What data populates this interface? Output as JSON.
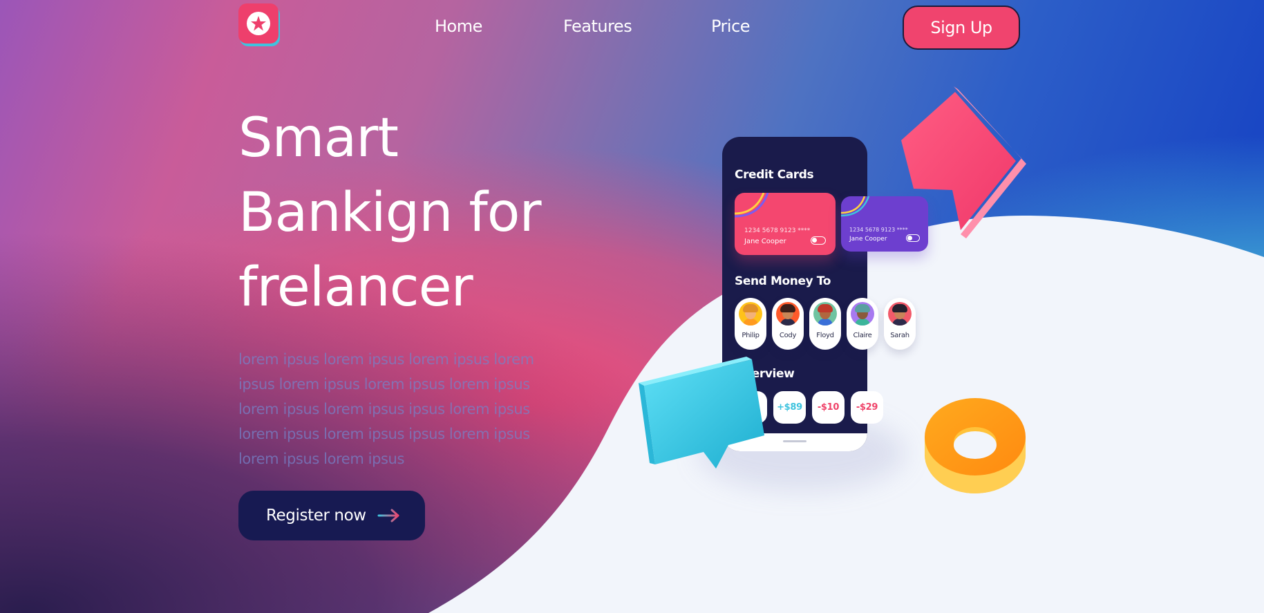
{
  "nav": {
    "links": [
      "Home",
      "Features",
      "Price"
    ],
    "signup_label": "Sign Up"
  },
  "hero": {
    "title_lines": [
      "Smart",
      "Bankign for",
      "frelancer"
    ],
    "body": "lorem ipsus lorem ipsus lorem ipsus lorem ipsus lorem ipsus lorem ipsus lorem ipsus lorem ipsus lorem ipsus ipsus lorem ipsus lorem ipsus lorem ipsus ipsus lorem ipsus lorem ipsus lorem ipsus",
    "cta_label": "Register now"
  },
  "phone": {
    "credit_cards_title": "Credit Cards",
    "cards": [
      {
        "number": "1234 5678 9123 ****",
        "holder": "Jane Cooper"
      },
      {
        "number": "1234 5678 9123 ****",
        "holder": "Jane Cooper"
      }
    ],
    "send_money_title": "Send Money To",
    "contacts": [
      "Philip",
      "Cody",
      "Floyd",
      "Claire",
      "Sarah"
    ],
    "overview_title": "Overview",
    "transactions": [
      {
        "amount": "-$",
        "color": "#ef4369"
      },
      {
        "amount": "+$89",
        "color": "#3ec3de"
      },
      {
        "amount": "-$10",
        "color": "#ef4369"
      },
      {
        "amount": "-$29",
        "color": "#ef4369"
      }
    ]
  },
  "colors": {
    "brand_pink": "#f0446e",
    "brand_navy": "#171a52",
    "accent_cyan": "#3ec3de",
    "accent_purple": "#6d3fcf",
    "accent_orange": "#ff9a1f"
  }
}
